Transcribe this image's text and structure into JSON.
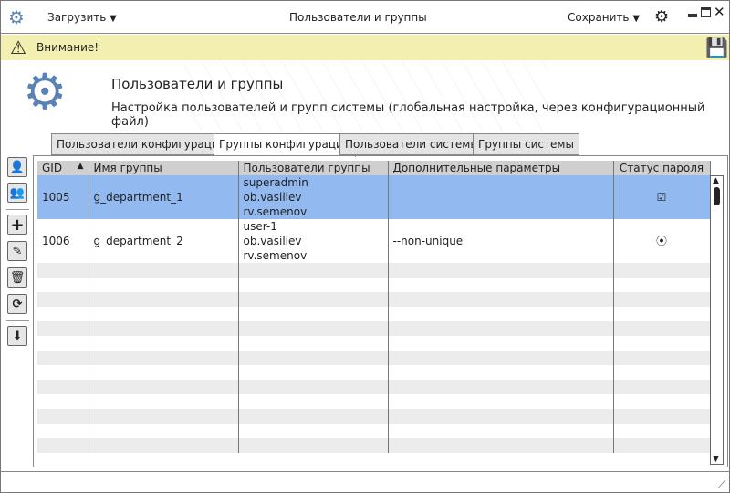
{
  "titlebar": {
    "load_label": "Загрузить",
    "title": "Пользователи и группы",
    "save_label": "Сохранить"
  },
  "warning": {
    "text": "Внимание!"
  },
  "header": {
    "title": "Пользователи и группы",
    "subtitle": "Настройка пользователей и групп системы (глобальная настройка, через конфигурационный файл)"
  },
  "tabs": [
    {
      "label": "Пользователи конфигурации"
    },
    {
      "label": "Группы конфигурации",
      "active": true
    },
    {
      "label": "Пользователи системы"
    },
    {
      "label": "Группы системы"
    }
  ],
  "table": {
    "columns": [
      "GID",
      "Имя группы",
      "Пользователи группы",
      "Дополнительные параметры",
      "Статус пароля"
    ],
    "sort": {
      "column": "GID",
      "direction": "asc"
    },
    "rows": [
      {
        "gid": "1005",
        "name": "g_department_1",
        "users": [
          "superadmin",
          "ob.vasiliev",
          "rv.semenov"
        ],
        "params": "",
        "status_icon": "checkbox-checked-icon",
        "status": "☑",
        "selected": true
      },
      {
        "gid": "1006",
        "name": "g_department_2",
        "users": [
          "user-1",
          "ob.vasiliev",
          "rv.semenov"
        ],
        "params": "--non-unique",
        "status_icon": "radio-dot-icon",
        "status": "⦿",
        "selected": false
      }
    ]
  },
  "colors": {
    "accent": "#5b82b5",
    "selection": "#93baf0",
    "warning": "#f3efb0"
  }
}
